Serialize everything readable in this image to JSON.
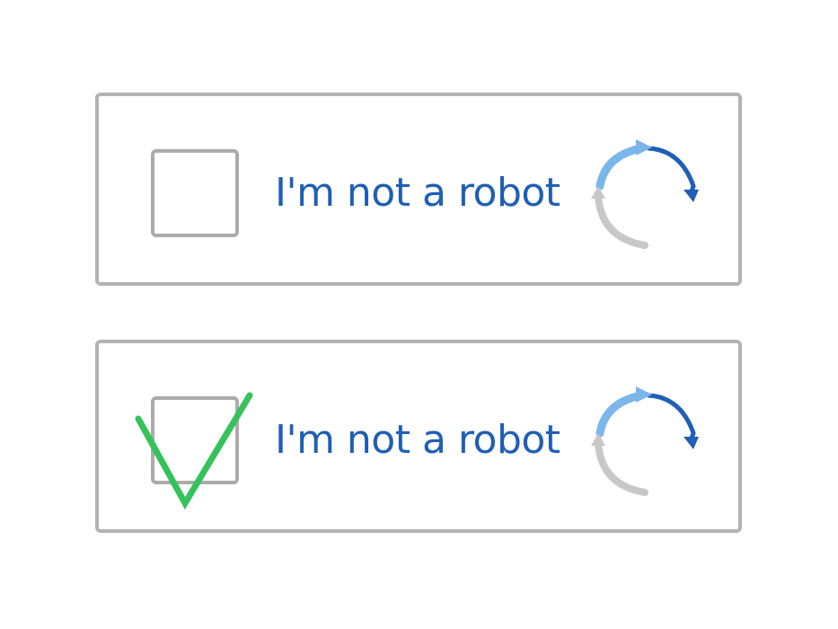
{
  "widgets": [
    {
      "checked": false,
      "label": "I'm not a robot"
    },
    {
      "checked": true,
      "label": "I'm not a robot"
    }
  ],
  "icons": {
    "refresh": "recaptcha-refresh-icon",
    "check": "checkmark-icon"
  },
  "colors": {
    "label": "#1f5fb5",
    "border": "#b3b3b3",
    "check": "#36c25a",
    "arrow_dark_blue": "#1f5fb5",
    "arrow_light_blue": "#7ab6ea",
    "arrow_gray": "#c8c8c8"
  }
}
